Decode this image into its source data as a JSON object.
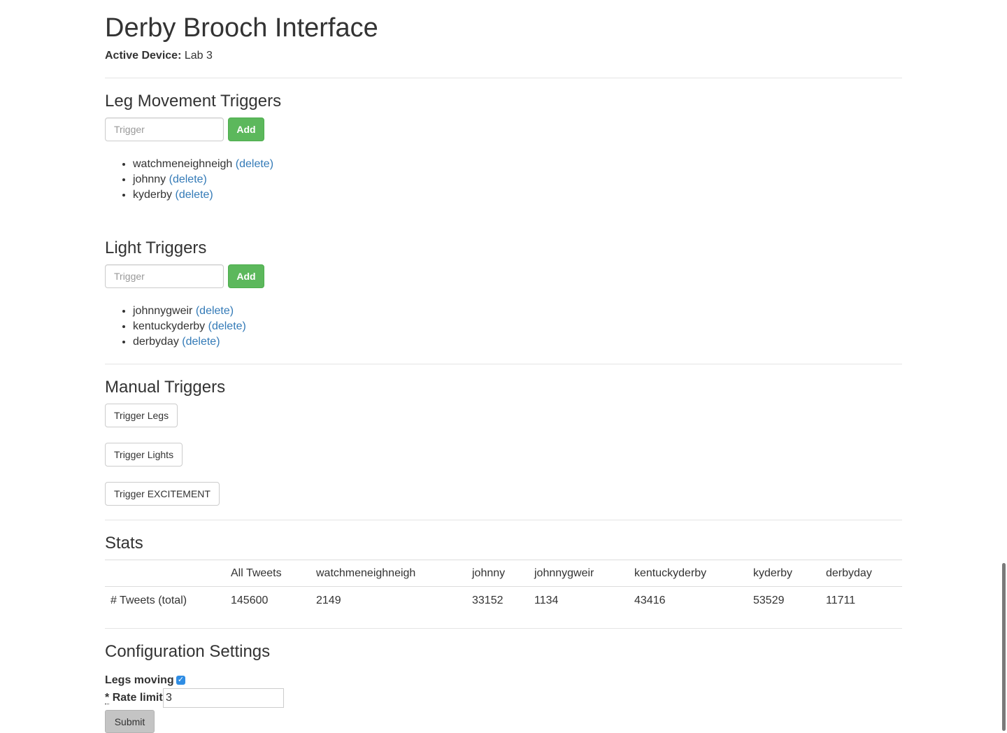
{
  "header": {
    "title": "Derby Brooch Interface",
    "active_device_label": "Active Device:",
    "active_device_value": "Lab 3"
  },
  "leg_triggers": {
    "heading": "Leg Movement Triggers",
    "input_placeholder": "Trigger",
    "add_label": "Add",
    "items": [
      {
        "name": "watchmeneighneigh",
        "delete": "(delete)"
      },
      {
        "name": "johnny",
        "delete": "(delete)"
      },
      {
        "name": "kyderby",
        "delete": "(delete)"
      }
    ]
  },
  "light_triggers": {
    "heading": "Light Triggers",
    "input_placeholder": "Trigger",
    "add_label": "Add",
    "items": [
      {
        "name": "johnnygweir",
        "delete": "(delete)"
      },
      {
        "name": "kentuckyderby",
        "delete": "(delete)"
      },
      {
        "name": "derbyday",
        "delete": "(delete)"
      }
    ]
  },
  "manual_triggers": {
    "heading": "Manual Triggers",
    "buttons": [
      "Trigger Legs",
      "Trigger Lights",
      "Trigger EXCITEMENT"
    ]
  },
  "stats": {
    "heading": "Stats",
    "columns": [
      "",
      "All Tweets",
      "watchmeneighneigh",
      "johnny",
      "johnnygweir",
      "kentuckyderby",
      "kyderby",
      "derbyday"
    ],
    "rows": [
      [
        "# Tweets (total)",
        "145600",
        "2149",
        "33152",
        "1134",
        "43416",
        "53529",
        "11711"
      ]
    ]
  },
  "config": {
    "heading": "Configuration Settings",
    "legs_moving_label": "Legs moving",
    "legs_moving_checked": true,
    "rate_limit_required": "*",
    "rate_limit_label": "Rate limit",
    "rate_limit_value": "3",
    "submit_label": "Submit"
  },
  "colors": {
    "add_button": "#5cb85c",
    "link": "#337ab7",
    "checkbox": "#2f8de4"
  }
}
